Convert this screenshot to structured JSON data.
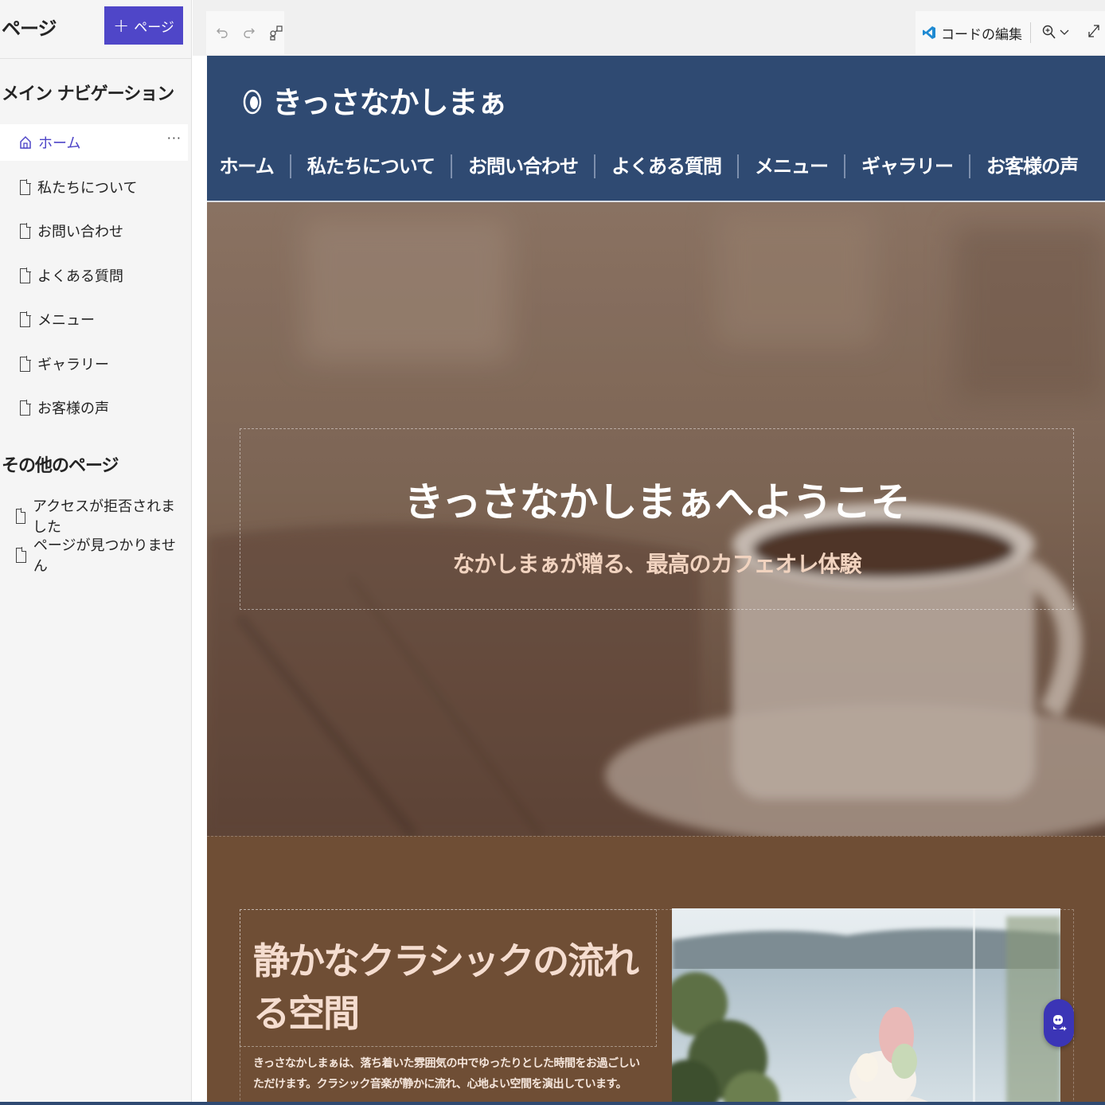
{
  "pages_panel": {
    "title": "ページ",
    "add_page_label": "ページ",
    "main_nav_title": "メイン ナビゲーション",
    "main_nav_items": [
      {
        "label": "ホーム",
        "icon": "home-icon",
        "active": true
      },
      {
        "label": "私たちについて",
        "icon": "page-icon"
      },
      {
        "label": "お問い合わせ",
        "icon": "page-icon"
      },
      {
        "label": "よくある質問",
        "icon": "page-icon"
      },
      {
        "label": "メニュー",
        "icon": "page-icon"
      },
      {
        "label": "ギャラリー",
        "icon": "page-icon"
      },
      {
        "label": "お客様の声",
        "icon": "page-icon"
      }
    ],
    "other_pages_title": "その他のページ",
    "other_pages_items": [
      {
        "label": "アクセスが拒否されました",
        "icon": "page-icon"
      },
      {
        "label": "ページが見つかりません",
        "icon": "page-icon"
      }
    ],
    "more_glyph": "···"
  },
  "toolbar": {
    "undo_icon": "undo-icon",
    "redo_icon": "redo-icon",
    "sitemap_icon": "sitemap-icon",
    "code_edit_label": "コードの編集",
    "zoom_icon": "zoom-icon",
    "expand_icon": "expand-icon"
  },
  "site": {
    "brand": "きっさなかしまぁ",
    "nav": [
      "ホーム",
      "私たちについて",
      "お問い合わせ",
      "よくある質問",
      "メニュー",
      "ギャラリー",
      "お客様の声"
    ],
    "hero_title": "きっさなかしまぁへようこそ",
    "hero_subtitle": "なかしまぁが贈る、最高のカフェオレ体験",
    "section2_title": "静かなクラシックの流れる空間",
    "section2_body": "きっさなかしまぁは、落ち着いた雰囲気の中でゆったりとした時間をお過ごしいただけます。クラシック音楽が静かに流れ、心地よい空間を演出しています。"
  },
  "colors": {
    "accent": "#4f46c8",
    "site_header": "#2f4a72",
    "site_section_bg": "#6f4e35",
    "hero_title": "#ffffff",
    "hero_subtitle": "#f1d3bf"
  }
}
